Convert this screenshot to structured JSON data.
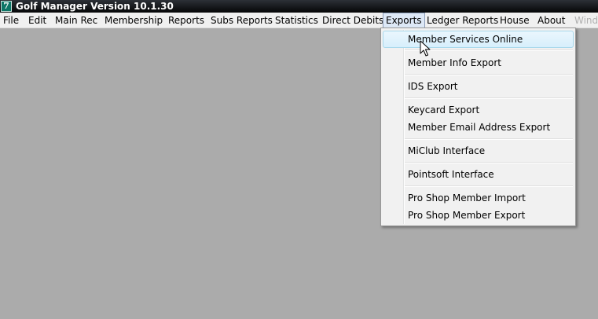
{
  "window": {
    "title": "Golf Manager Version 10.1.30",
    "icon_glyph": "7",
    "icon_color": "#0d7566"
  },
  "menubar": {
    "items": [
      "File",
      "Edit",
      "Main Rec",
      "Membership",
      "Reports",
      "Subs Reports",
      "Statistics",
      "Direct Debits",
      "Exports",
      "Ledger Reports",
      "House",
      "About",
      "Windo"
    ],
    "active_item": "Exports"
  },
  "exports_menu": {
    "items": [
      "Member Services Online",
      "Member Info Export",
      "IDS Export",
      "Keycard Export",
      "Member Email Address Export",
      "MiClub Interface",
      "Pointsoft Interface",
      "Pro Shop Member Import",
      "Pro Shop Member Export"
    ],
    "highlighted_item": "Member Services Online"
  },
  "colors": {
    "desktop": "#ababab",
    "highlight": "#d7effc",
    "titlebar": "#050607"
  },
  "cursor": "arrow-pointer-icon"
}
